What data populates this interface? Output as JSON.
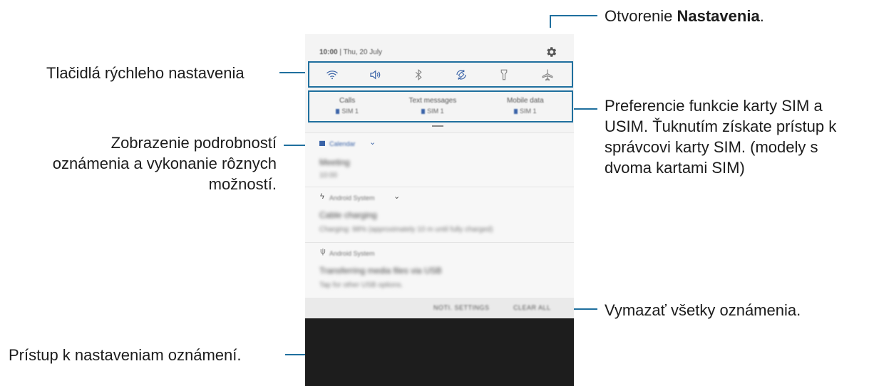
{
  "callouts": {
    "settings_prefix": "Otvorenie ",
    "settings_bold": "Nastavenia",
    "settings_suffix": ".",
    "quick_settings": "Tlačidlá rýchleho nastavenia",
    "sim_line1": "Preferencie funkcie karty SIM a",
    "sim_line2": "USIM. Ťuknutím získate prístup k",
    "sim_line3": "správcovi karty SIM. (modely s",
    "sim_line4": "dvoma kartami SIM)",
    "notif_line1": "Zobrazenie podrobností",
    "notif_line2": "oznámenia a vykonanie rôznych",
    "notif_line3": "možností.",
    "clear_all": "Vymazať všetky oznámenia.",
    "notif_settings": "Prístup k nastaveniam oznámení."
  },
  "phone": {
    "status": {
      "time": "10:00",
      "date": "Thu, 20 July"
    },
    "quick_settings": [
      "wifi-icon",
      "sound-icon",
      "bluetooth-icon",
      "auto-rotate-icon",
      "flashlight-icon",
      "airplane-icon"
    ],
    "sim": [
      {
        "label": "Calls",
        "sub": "SIM 1"
      },
      {
        "label": "Text messages",
        "sub": "SIM 1"
      },
      {
        "label": "Mobile data",
        "sub": "SIM 1"
      }
    ],
    "notifications": [
      {
        "app": "Calendar",
        "title": "Meeting",
        "body": "10:00"
      },
      {
        "app": "Android System",
        "title": "Cable charging",
        "body": "Charging: 98% (approximately 10 m until fully charged)"
      },
      {
        "app": "Android System",
        "title": "Transferring media files via USB",
        "body": "Tap for other USB options."
      }
    ],
    "footer": {
      "notif_settings": "NOTI. SETTINGS",
      "clear_all": "CLEAR ALL"
    }
  },
  "colors": {
    "accent": "#1f6f9e",
    "icon": "#3b64a8"
  }
}
